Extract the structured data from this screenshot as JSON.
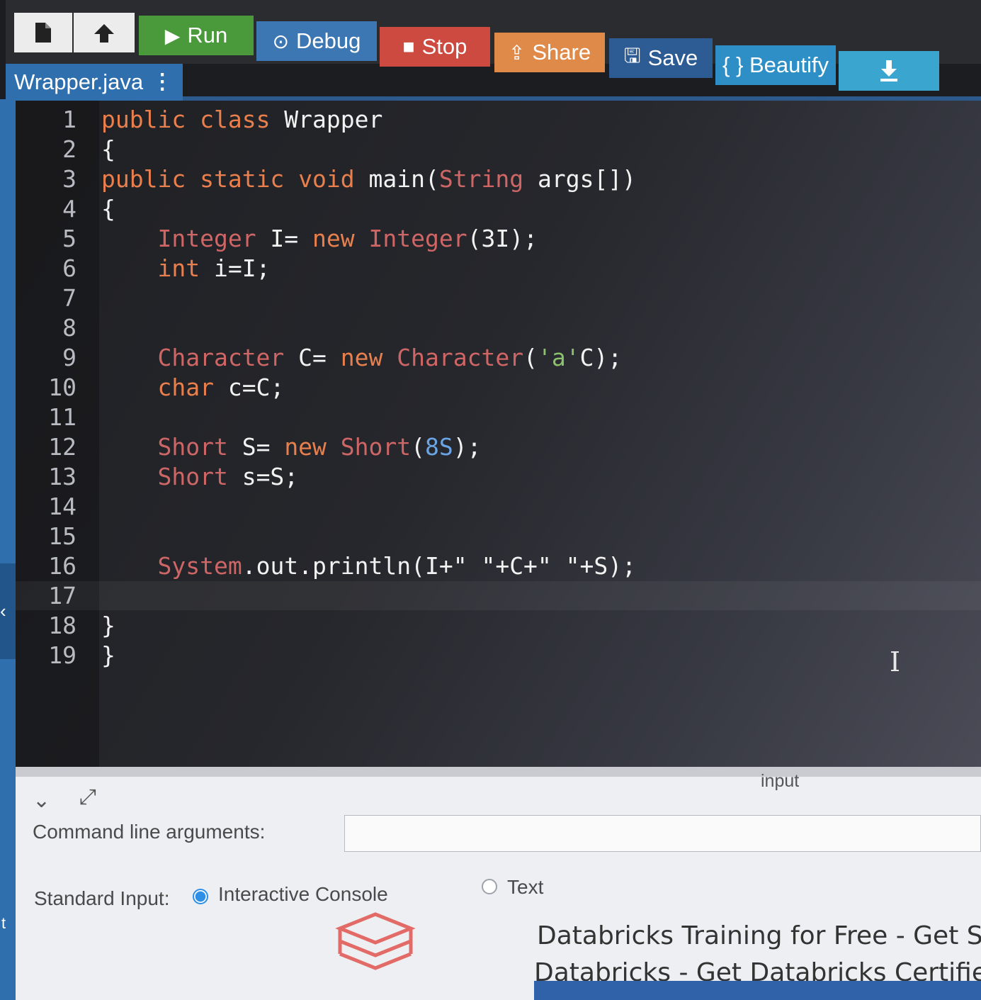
{
  "toolbar": {
    "new_icon": "new-file-icon",
    "upload_icon": "upload-icon",
    "run_label": "Run",
    "debug_label": "Debug",
    "stop_label": "Stop",
    "share_label": "Share",
    "save_label": "Save",
    "beautify_label": "{ } Beautify",
    "download_icon": "download-icon",
    "colors": {
      "run": "#4a9a3c",
      "debug": "#3d77b3",
      "stop": "#cc4a3f",
      "share": "#e08a4a",
      "save": "#2d5c94",
      "beautify": "#2d8fc6",
      "download": "#3aa6cf"
    }
  },
  "file_tab": {
    "name": "Wrapper.java",
    "menu_icon": "vertical-dots-icon"
  },
  "editor": {
    "line_numbers": [
      "1",
      "2",
      "3",
      "4",
      "5",
      "6",
      "7",
      "8",
      "9",
      "10",
      "11",
      "12",
      "13",
      "14",
      "15",
      "16",
      "17",
      "18",
      "19"
    ],
    "active_line": "17",
    "lines": {
      "l1": {
        "k1": "public",
        "sp1": " ",
        "k2": "class",
        "rest": " Wrapper"
      },
      "l2": {
        "rest": "{"
      },
      "l3": {
        "k1": "public",
        "sp1": " ",
        "k2": "static",
        "sp2": " ",
        "k3": "void",
        "mid": " main(",
        "t1": "String",
        "rest": " args[])"
      },
      "l4": {
        "rest": "{"
      },
      "l5": {
        "indent": "    ",
        "t1": "Integer",
        "mid": " I= ",
        "k1": "new",
        "sp1": " ",
        "t2": "Integer",
        "rest": "(3I);"
      },
      "l6": {
        "indent": "    ",
        "k1": "int",
        "rest": " i=I;"
      },
      "l9": {
        "indent": "    ",
        "t1": "Character",
        "mid": " C= ",
        "k1": "new",
        "sp1": " ",
        "t2": "Character",
        "p1": "(",
        "s1": "'a'",
        "rest": "C);"
      },
      "l10": {
        "indent": "    ",
        "k1": "char",
        "rest": " c=C;"
      },
      "l12": {
        "indent": "    ",
        "t1": "Short",
        "mid": " S= ",
        "k1": "new",
        "sp1": " ",
        "t2": "Short",
        "p1": "(",
        "n1": "8S",
        "rest": ");"
      },
      "l13": {
        "indent": "    ",
        "t1": "Short",
        "rest": " s=S;"
      },
      "l16": {
        "indent": "    ",
        "t1": "System",
        "rest": ".out.println(I+\" \"+C+\" \"+S);"
      },
      "l18": {
        "rest": "}"
      },
      "l19": {
        "rest": "}"
      }
    },
    "text_cursor_icon": "i-beam-cursor-icon"
  },
  "panel": {
    "collapse_icon": "chevron-down-icon",
    "expand_icon": "expand-arrows-icon",
    "input_tab": "input",
    "cla_label": "Command line arguments:",
    "cla_value": "",
    "stdin_label": "Standard Input:",
    "stdin_options": [
      "Interactive Console",
      "Text"
    ],
    "stdin_selected": "Interactive Console"
  },
  "ad": {
    "logo_icon": "databricks-logo",
    "line1": "Databricks Training for Free - Get St",
    "line2": "Databricks - Get Databricks Certifie"
  }
}
